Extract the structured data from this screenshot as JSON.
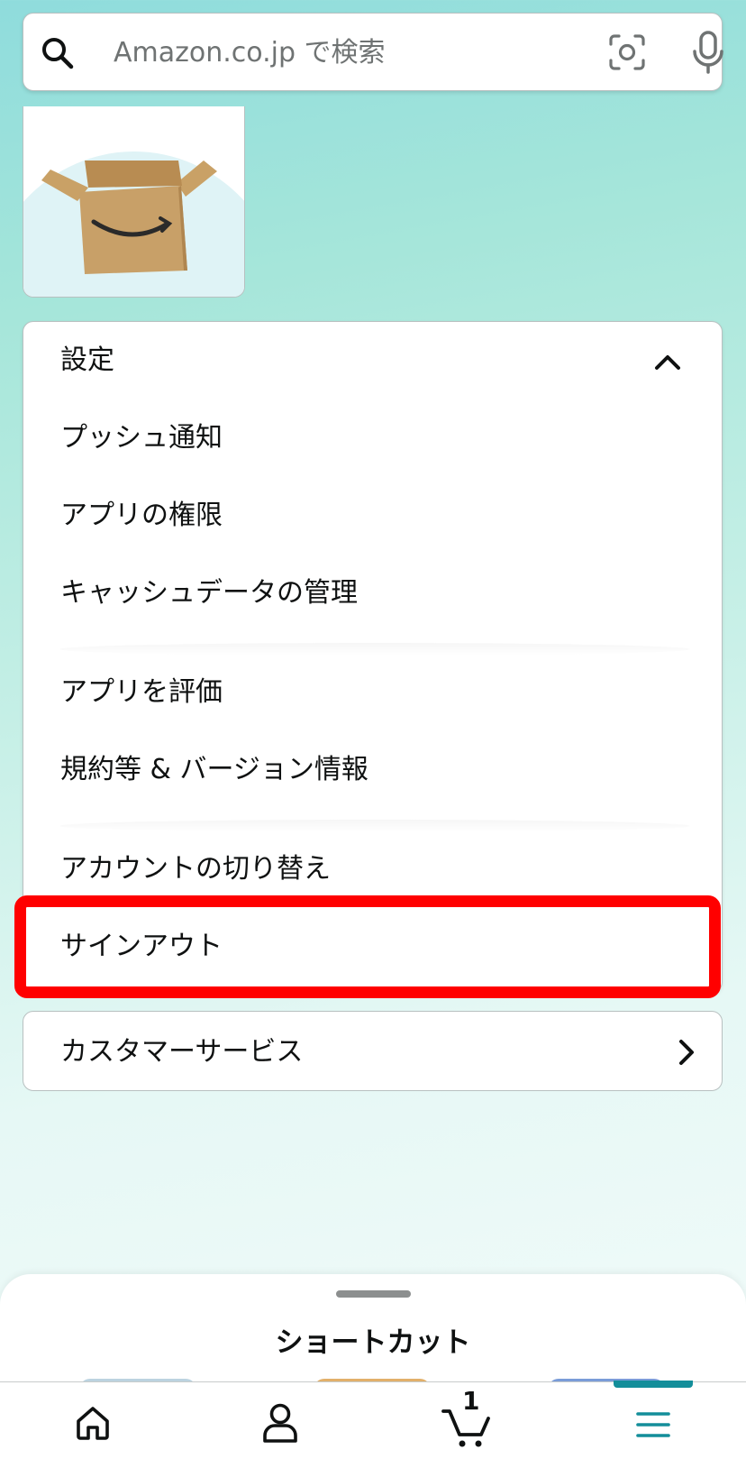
{
  "search": {
    "placeholder": "Amazon.co.jp で検索",
    "icons": [
      "search-icon",
      "camera-scan-icon",
      "microphone-icon"
    ]
  },
  "settings": {
    "header": "設定",
    "items": [
      {
        "label": "プッシュ通知"
      },
      {
        "label": "アプリの権限"
      },
      {
        "label": "キャッシュデータの管理"
      },
      {
        "label": "アプリを評価"
      },
      {
        "label": "規約等 & バージョン情報"
      },
      {
        "label": "アカウントの切り替え"
      },
      {
        "label": "サインアウト"
      }
    ]
  },
  "customer_service": {
    "label": "カスタマーサービス"
  },
  "shortcuts": {
    "title": "ショートカット"
  },
  "nav": {
    "items": [
      "home-icon",
      "account-icon",
      "cart-icon",
      "menu-icon"
    ],
    "cart_count": "1",
    "active": "menu"
  },
  "colors": {
    "highlight": "#ff0000",
    "accent": "#138e9a"
  }
}
